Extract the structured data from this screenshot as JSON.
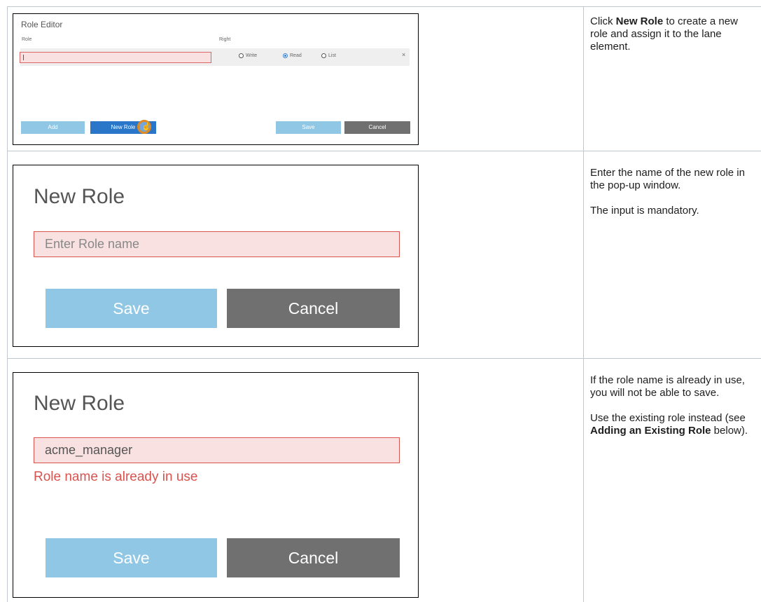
{
  "rows": [
    {
      "role_editor": {
        "title": "Role Editor",
        "col_role": "Role",
        "col_right": "Right",
        "rights": [
          {
            "label": "Write",
            "selected": false
          },
          {
            "label": "Read",
            "selected": true
          },
          {
            "label": "List",
            "selected": false
          }
        ],
        "remove_icon": "×",
        "buttons": {
          "add": "Add",
          "new_role": "New Role",
          "save": "Save",
          "cancel": "Cancel"
        }
      },
      "note": {
        "pre": "Click ",
        "bold": "New Role",
        "post": " to create a new role and assign it to the lane element."
      }
    },
    {
      "dialog": {
        "title": "New Role",
        "input_placeholder": "Enter Role name",
        "save": "Save",
        "cancel": "Cancel"
      },
      "note": {
        "p1": "Enter the name of the new role in the pop-up window.",
        "p2": "The input is mandatory."
      }
    },
    {
      "dialog": {
        "title": "New Role",
        "input_value": "acme_manager",
        "error": "Role name is already in use",
        "save": "Save",
        "cancel": "Cancel"
      },
      "note": {
        "p1": "If the role name is already in use, you will not be able to save.",
        "p2_pre": "Use the existing role instead (see ",
        "p2_bold": "Adding an Existing Role",
        "p2_post": " below)."
      }
    }
  ],
  "colors": {
    "accent_blue": "#2a77c9",
    "light_blue": "#8fc7e5",
    "cancel_gray": "#707070",
    "error_red": "#d9534f",
    "cursor_ring": "#e08a24"
  }
}
